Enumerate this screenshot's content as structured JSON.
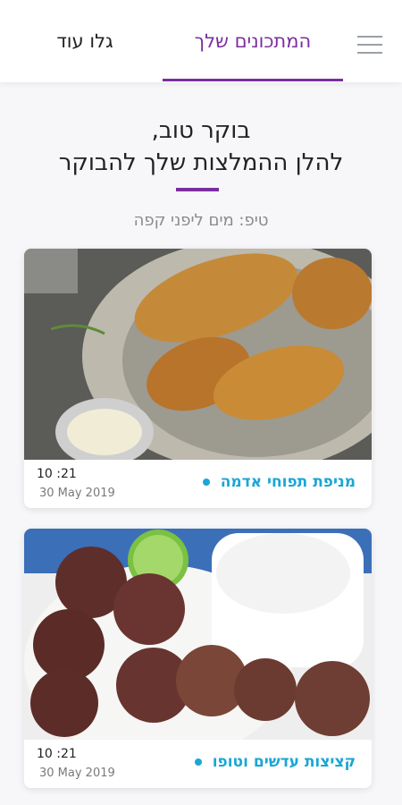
{
  "header": {
    "tabs": [
      {
        "label": "המתכונים שלך",
        "active": true
      },
      {
        "label": "גלו עוד",
        "active": false
      }
    ],
    "accent_color": "#7a2e9e"
  },
  "greeting": {
    "line1": "בוקר טוב,",
    "line2": "להלן ההמלצות שלך להבוקר"
  },
  "tip": "טיפ: מים ליפני קפה",
  "recipes": [
    {
      "title": "מניפת תפוחי אדמה",
      "time": "10 :21",
      "date": "30 May 2019",
      "image": "hasselback-potatoes-photo"
    },
    {
      "title": "קציצות עדשים וטופו",
      "time": "10 :21",
      "date": "30 May 2019",
      "image": "lentil-tofu-patties-photo"
    }
  ]
}
